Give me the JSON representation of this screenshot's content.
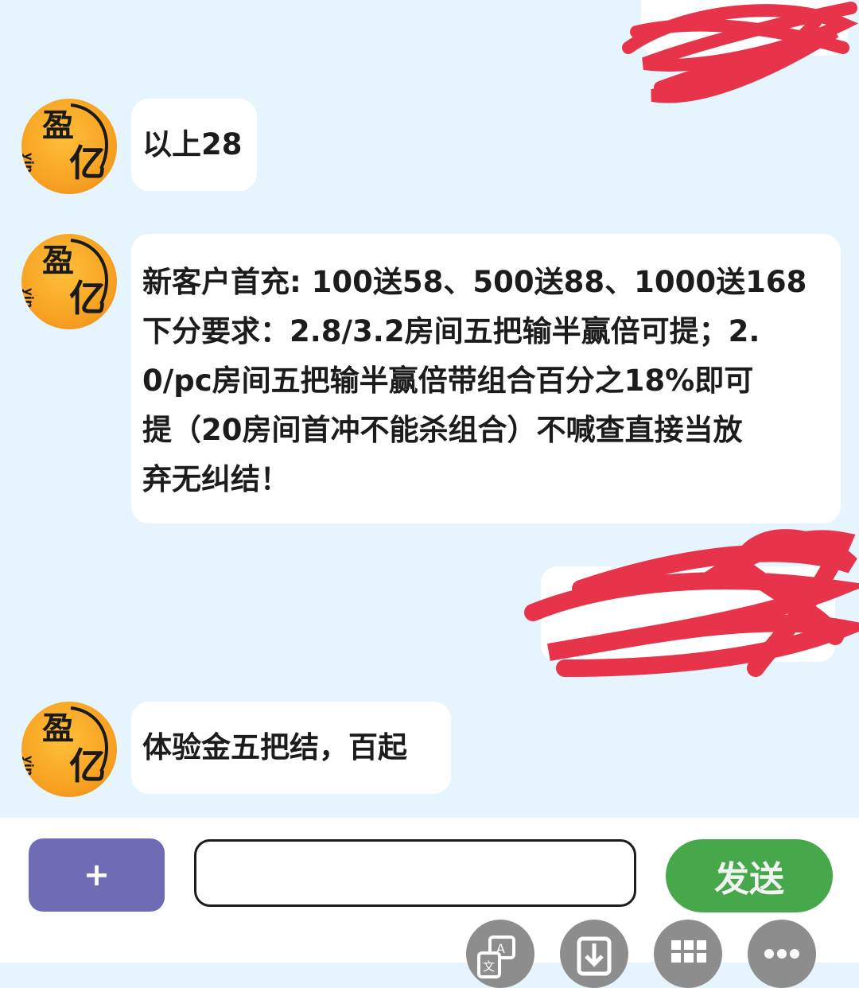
{
  "avatar": {
    "chars": [
      "盈",
      "亿"
    ],
    "brand": "yingyi"
  },
  "messages": [
    {
      "text": "以上28"
    },
    {
      "text": "新客户首充: 100送58、500送88、1000送168\n下分要求：2.8/3.2房间五把输半赢倍可提；2.\n0/pc房间五把输半赢倍带组合百分之18%即可\n提（20房间首冲不能杀组合）不喊查直接当放\n弃无纠结！"
    },
    {
      "text": "体验金五把结，百起"
    }
  ],
  "input_bar": {
    "plus_label": "+",
    "input_value": "",
    "send_label": "发送"
  },
  "toolbar_icons": [
    "translate-icon",
    "download-icon",
    "grid-icon",
    "more-icon"
  ],
  "colors": {
    "chat_background": "#e5f4fd",
    "plus_button": "#6f6bb5",
    "send_button": "#46a84a",
    "redaction": "#e8344a"
  }
}
